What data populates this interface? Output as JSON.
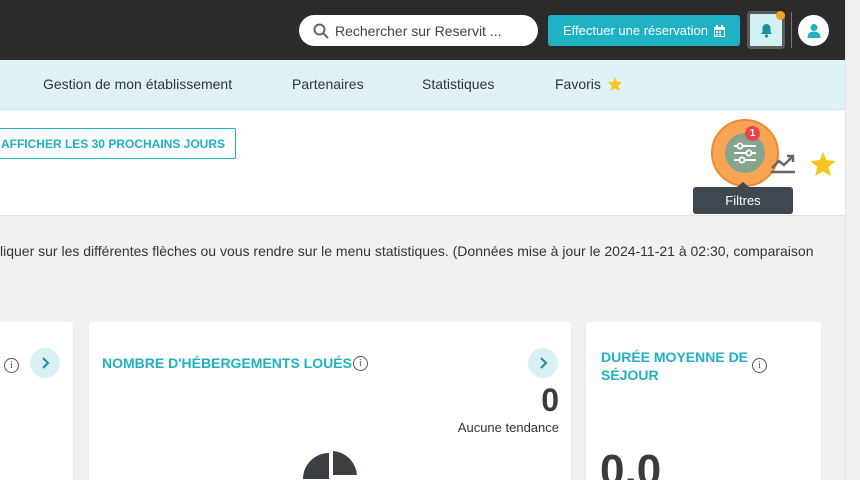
{
  "header": {
    "search_placeholder": "Rechercher sur Reservit ...",
    "reserve_label": "Effectuer une réservation"
  },
  "nav": {
    "items": [
      {
        "label": "Gestion de mon établissement"
      },
      {
        "label": "Partenaires"
      },
      {
        "label": "Statistiques"
      },
      {
        "label": "Favoris"
      }
    ]
  },
  "panel": {
    "next_days_label": "AFFICHER LES 30 PROCHAINS JOURS",
    "filter_badge": "1",
    "tooltip": "Filtres"
  },
  "info_text": "liquer sur les différentes flèches ou vous rendre sur le menu statistiques. (Données mise à jour le 2024-11-21 à 02:30, comparaison",
  "cards": {
    "rented": {
      "title": "NOMBRE D'HÉBERGEMENTS LOUÉS",
      "value": "0",
      "trend": "Aucune tendance"
    },
    "stay": {
      "title": "DURÉE MOYENNE DE SÉJOUR",
      "value": "0,0"
    }
  },
  "colors": {
    "accent": "#1fb1c4",
    "topbar": "#2b2b2b",
    "navbar": "#dff3f7",
    "highlight": "#f7a552",
    "star": "#f6c623"
  }
}
